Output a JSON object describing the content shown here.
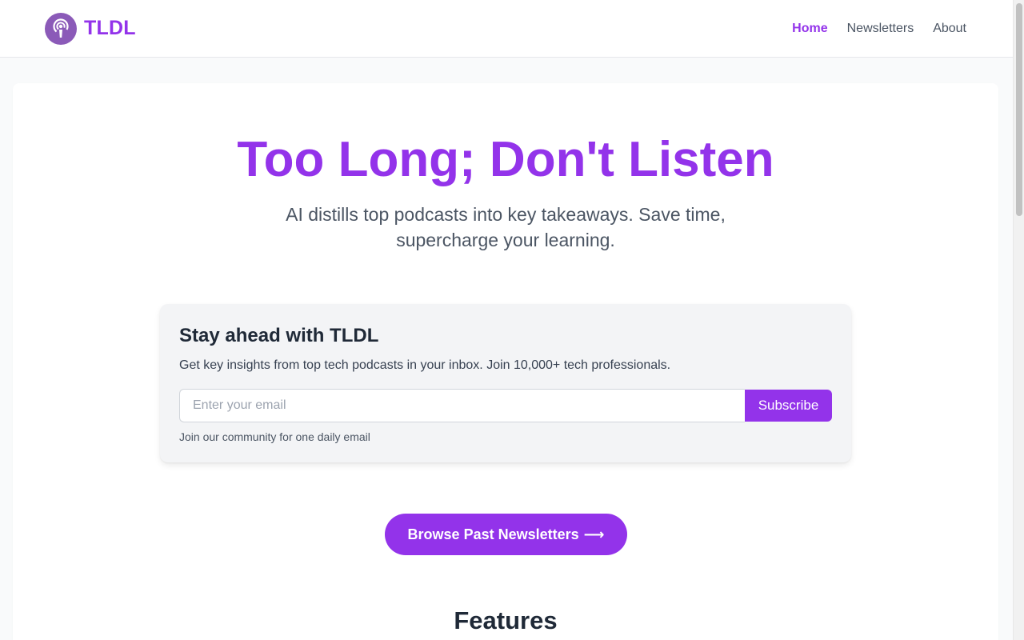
{
  "brand": {
    "name": "TLDL",
    "logo_icon": "podcast-icon",
    "logo_color": "#8b5ab8",
    "accent": "#9333ea"
  },
  "nav": {
    "items": [
      {
        "label": "Home",
        "active": true
      },
      {
        "label": "Newsletters",
        "active": false
      },
      {
        "label": "About",
        "active": false
      }
    ]
  },
  "hero": {
    "title": "Too Long; Don't Listen",
    "subtitle_line1": "AI distills top podcasts into key takeaways. Save time,",
    "subtitle_line2": "supercharge your learning."
  },
  "signup": {
    "title": "Stay ahead with TLDL",
    "description": "Get key insights from top tech podcasts in your inbox. Join 10,000+ tech professionals.",
    "email_placeholder": "Enter your email",
    "email_value": "",
    "button_label": "Subscribe",
    "note": "Join our community for one daily email"
  },
  "browse": {
    "label": "Browse Past Newsletters",
    "arrow": "⟶"
  },
  "features": {
    "title": "Features"
  }
}
